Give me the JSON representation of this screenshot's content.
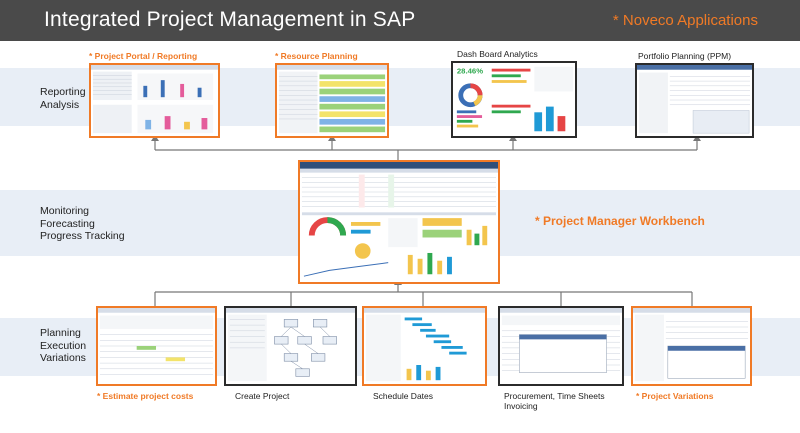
{
  "header": {
    "title": "Integrated Project Management in SAP",
    "brand": "* Noveco Applications"
  },
  "rows": {
    "reporting": "Reporting\nAnalysis",
    "monitoring": "Monitoring\nForecasting\nProgress Tracking",
    "planning": "Planning\nExecution\nVariations"
  },
  "top": {
    "portal": "* Project Portal / Reporting",
    "resource": "* Resource Planning",
    "dashboard": "Dash Board Analytics",
    "portfolio": "Portfolio Planning (PPM)"
  },
  "middle": {
    "workbench": "* Project Manager Workbench"
  },
  "bottom": {
    "estimate": "* Estimate project costs",
    "create": "Create Project",
    "schedule": "Schedule Dates",
    "procurement": "Procurement, Time Sheets\nInvoicing",
    "variations": "* Project Variations"
  },
  "screens": {
    "dashboard_percent": "28.46%"
  },
  "colors": {
    "header_bg": "#4a4a4a",
    "accent": "#f07a26",
    "band": "#e8eef6",
    "dark_border": "#2b2b2b"
  }
}
